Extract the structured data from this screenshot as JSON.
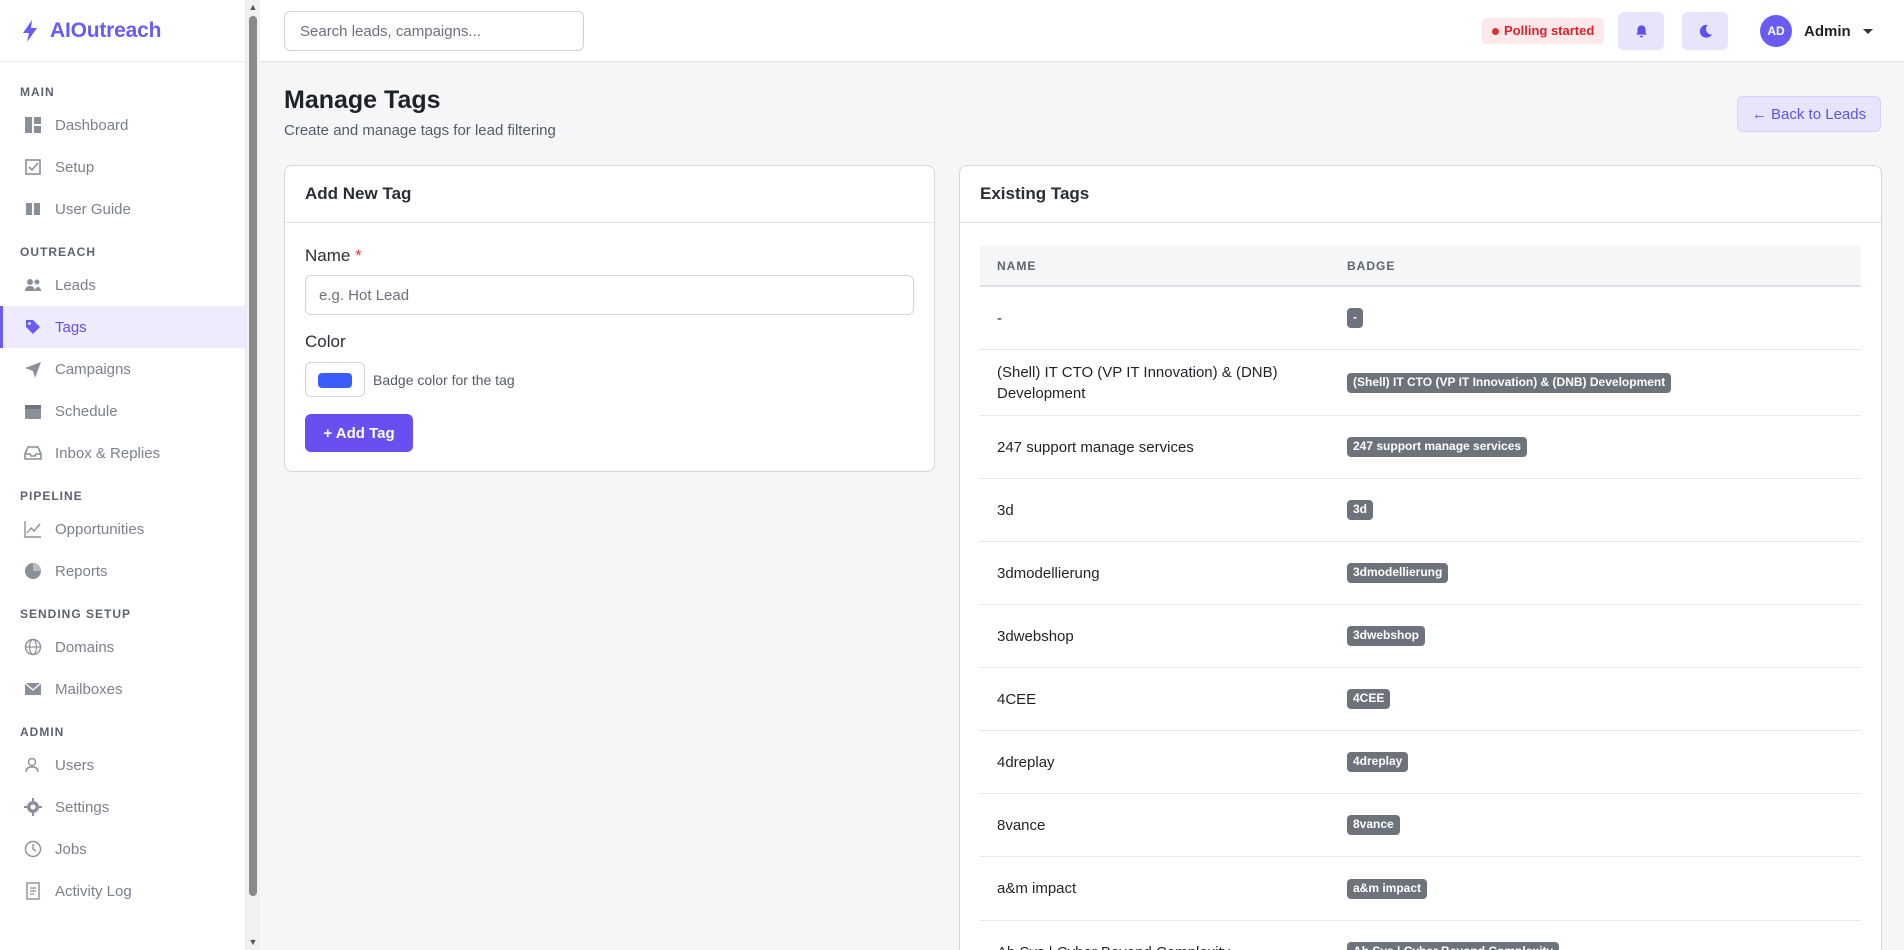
{
  "app": {
    "name": "AIOutreach"
  },
  "sidebar": {
    "sections": [
      {
        "title": "MAIN",
        "items": [
          {
            "label": "Dashboard",
            "icon": "dashboard-icon"
          },
          {
            "label": "Setup",
            "icon": "checkbox-icon"
          },
          {
            "label": "User Guide",
            "icon": "book-icon"
          }
        ]
      },
      {
        "title": "OUTREACH",
        "items": [
          {
            "label": "Leads",
            "icon": "users-icon"
          },
          {
            "label": "Tags",
            "icon": "tag-icon",
            "active": true
          },
          {
            "label": "Campaigns",
            "icon": "send-icon"
          },
          {
            "label": "Schedule",
            "icon": "calendar-icon"
          },
          {
            "label": "Inbox & Replies",
            "icon": "inbox-icon"
          }
        ]
      },
      {
        "title": "PIPELINE",
        "items": [
          {
            "label": "Opportunities",
            "icon": "chart-line-icon"
          },
          {
            "label": "Reports",
            "icon": "pie-chart-icon"
          }
        ]
      },
      {
        "title": "SENDING SETUP",
        "items": [
          {
            "label": "Domains",
            "icon": "globe-icon"
          },
          {
            "label": "Mailboxes",
            "icon": "envelope-icon"
          }
        ]
      },
      {
        "title": "ADMIN",
        "items": [
          {
            "label": "Users",
            "icon": "user-icon"
          },
          {
            "label": "Settings",
            "icon": "gear-icon"
          },
          {
            "label": "Jobs",
            "icon": "clock-icon"
          },
          {
            "label": "Activity Log",
            "icon": "log-icon"
          }
        ]
      }
    ]
  },
  "topbar": {
    "search_placeholder": "Search leads, campaigns...",
    "status": "Polling started",
    "user": {
      "initials": "AD",
      "name": "Admin"
    }
  },
  "page": {
    "title": "Manage Tags",
    "subtitle": "Create and manage tags for lead filtering",
    "back_label": "← Back to Leads"
  },
  "add_tag": {
    "title": "Add New Tag",
    "name_label": "Name",
    "required_mark": "*",
    "name_placeholder": "e.g. Hot Lead",
    "color_label": "Color",
    "color_value": "#3b5bfd",
    "color_hint": "Badge color for the tag",
    "submit_label": "+ Add Tag"
  },
  "tags": {
    "title": "Existing Tags",
    "columns": [
      "NAME",
      "BADGE"
    ],
    "badge_color": "#6c737b",
    "rows": [
      {
        "name": "-",
        "badge": "-"
      },
      {
        "name": "(Shell) IT CTO (VP IT Innovation) & (DNB) Development",
        "badge": "(Shell) IT CTO (VP IT Innovation) & (DNB) Development"
      },
      {
        "name": "247 support manage services",
        "badge": "247 support manage services"
      },
      {
        "name": "3d",
        "badge": "3d"
      },
      {
        "name": "3dmodellierung",
        "badge": "3dmodellierung"
      },
      {
        "name": "3dwebshop",
        "badge": "3dwebshop"
      },
      {
        "name": "4CEE",
        "badge": "4CEE"
      },
      {
        "name": "4dreplay",
        "badge": "4dreplay"
      },
      {
        "name": "8vance",
        "badge": "8vance"
      },
      {
        "name": "a&m impact",
        "badge": "a&m impact"
      },
      {
        "name": "Ab Sys | Cyber Beyond Complexity",
        "badge": "Ab Sys | Cyber Beyond Complexity"
      }
    ]
  }
}
